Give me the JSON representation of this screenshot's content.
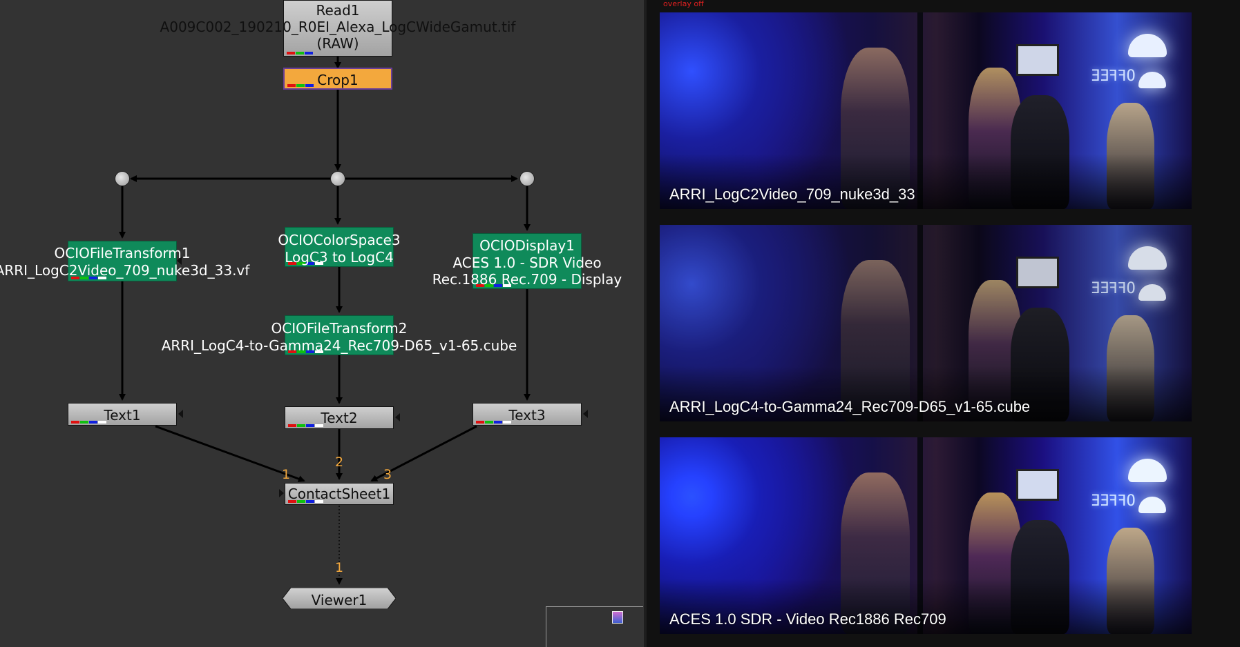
{
  "node_graph": {
    "read": {
      "title": "Read1",
      "file": "A009C002_190210_R0EI_Alexa_LogCWideGamut.tif",
      "mode": "(RAW)"
    },
    "crop": {
      "title": "Crop1"
    },
    "ocio_file_transform1": {
      "title": "OCIOFileTransform1",
      "file": "ARRI_LogC2Video_709_nuke3d_33.vf"
    },
    "ocio_colorspace": {
      "title": "OCIOColorSpace3",
      "detail": "LogC3 to LogC4"
    },
    "ocio_display": {
      "title": "OCIODisplay1",
      "line1": "ACES 1.0 - SDR Video",
      "line2": "Rec.1886 Rec.709 - Display"
    },
    "ocio_file_transform2": {
      "title": "OCIOFileTransform2",
      "file": "ARRI_LogC4-to-Gamma24_Rec709-D65_v1-65.cube"
    },
    "text1": {
      "title": "Text1"
    },
    "text2": {
      "title": "Text2"
    },
    "text3": {
      "title": "Text3"
    },
    "contact_sheet": {
      "title": "ContactSheet1"
    },
    "viewer": {
      "title": "Viewer1"
    },
    "input_numbers": {
      "cs_in1": "1",
      "cs_in2": "2",
      "cs_in3": "3",
      "viewer_in1": "1"
    }
  },
  "viewer_panel": {
    "overlay_status": "overlay off",
    "frames": [
      {
        "caption": "ARRI_LogC2Video_709_nuke3d_33"
      },
      {
        "caption": "ARRI_LogC4-to-Gamma24_Rec709-D65_v1-65.cube"
      },
      {
        "caption": "ACES 1.0 SDR - Video Rec1886 Rec709"
      }
    ],
    "sign_text": "ƎƎꟻꟻO"
  },
  "colors": {
    "graph_bg": "#333333",
    "node_green": "#0f8a5a",
    "node_orange": "#f3a83d",
    "node_gray": "#b8b8b8",
    "input_number": "#f3a83d"
  }
}
